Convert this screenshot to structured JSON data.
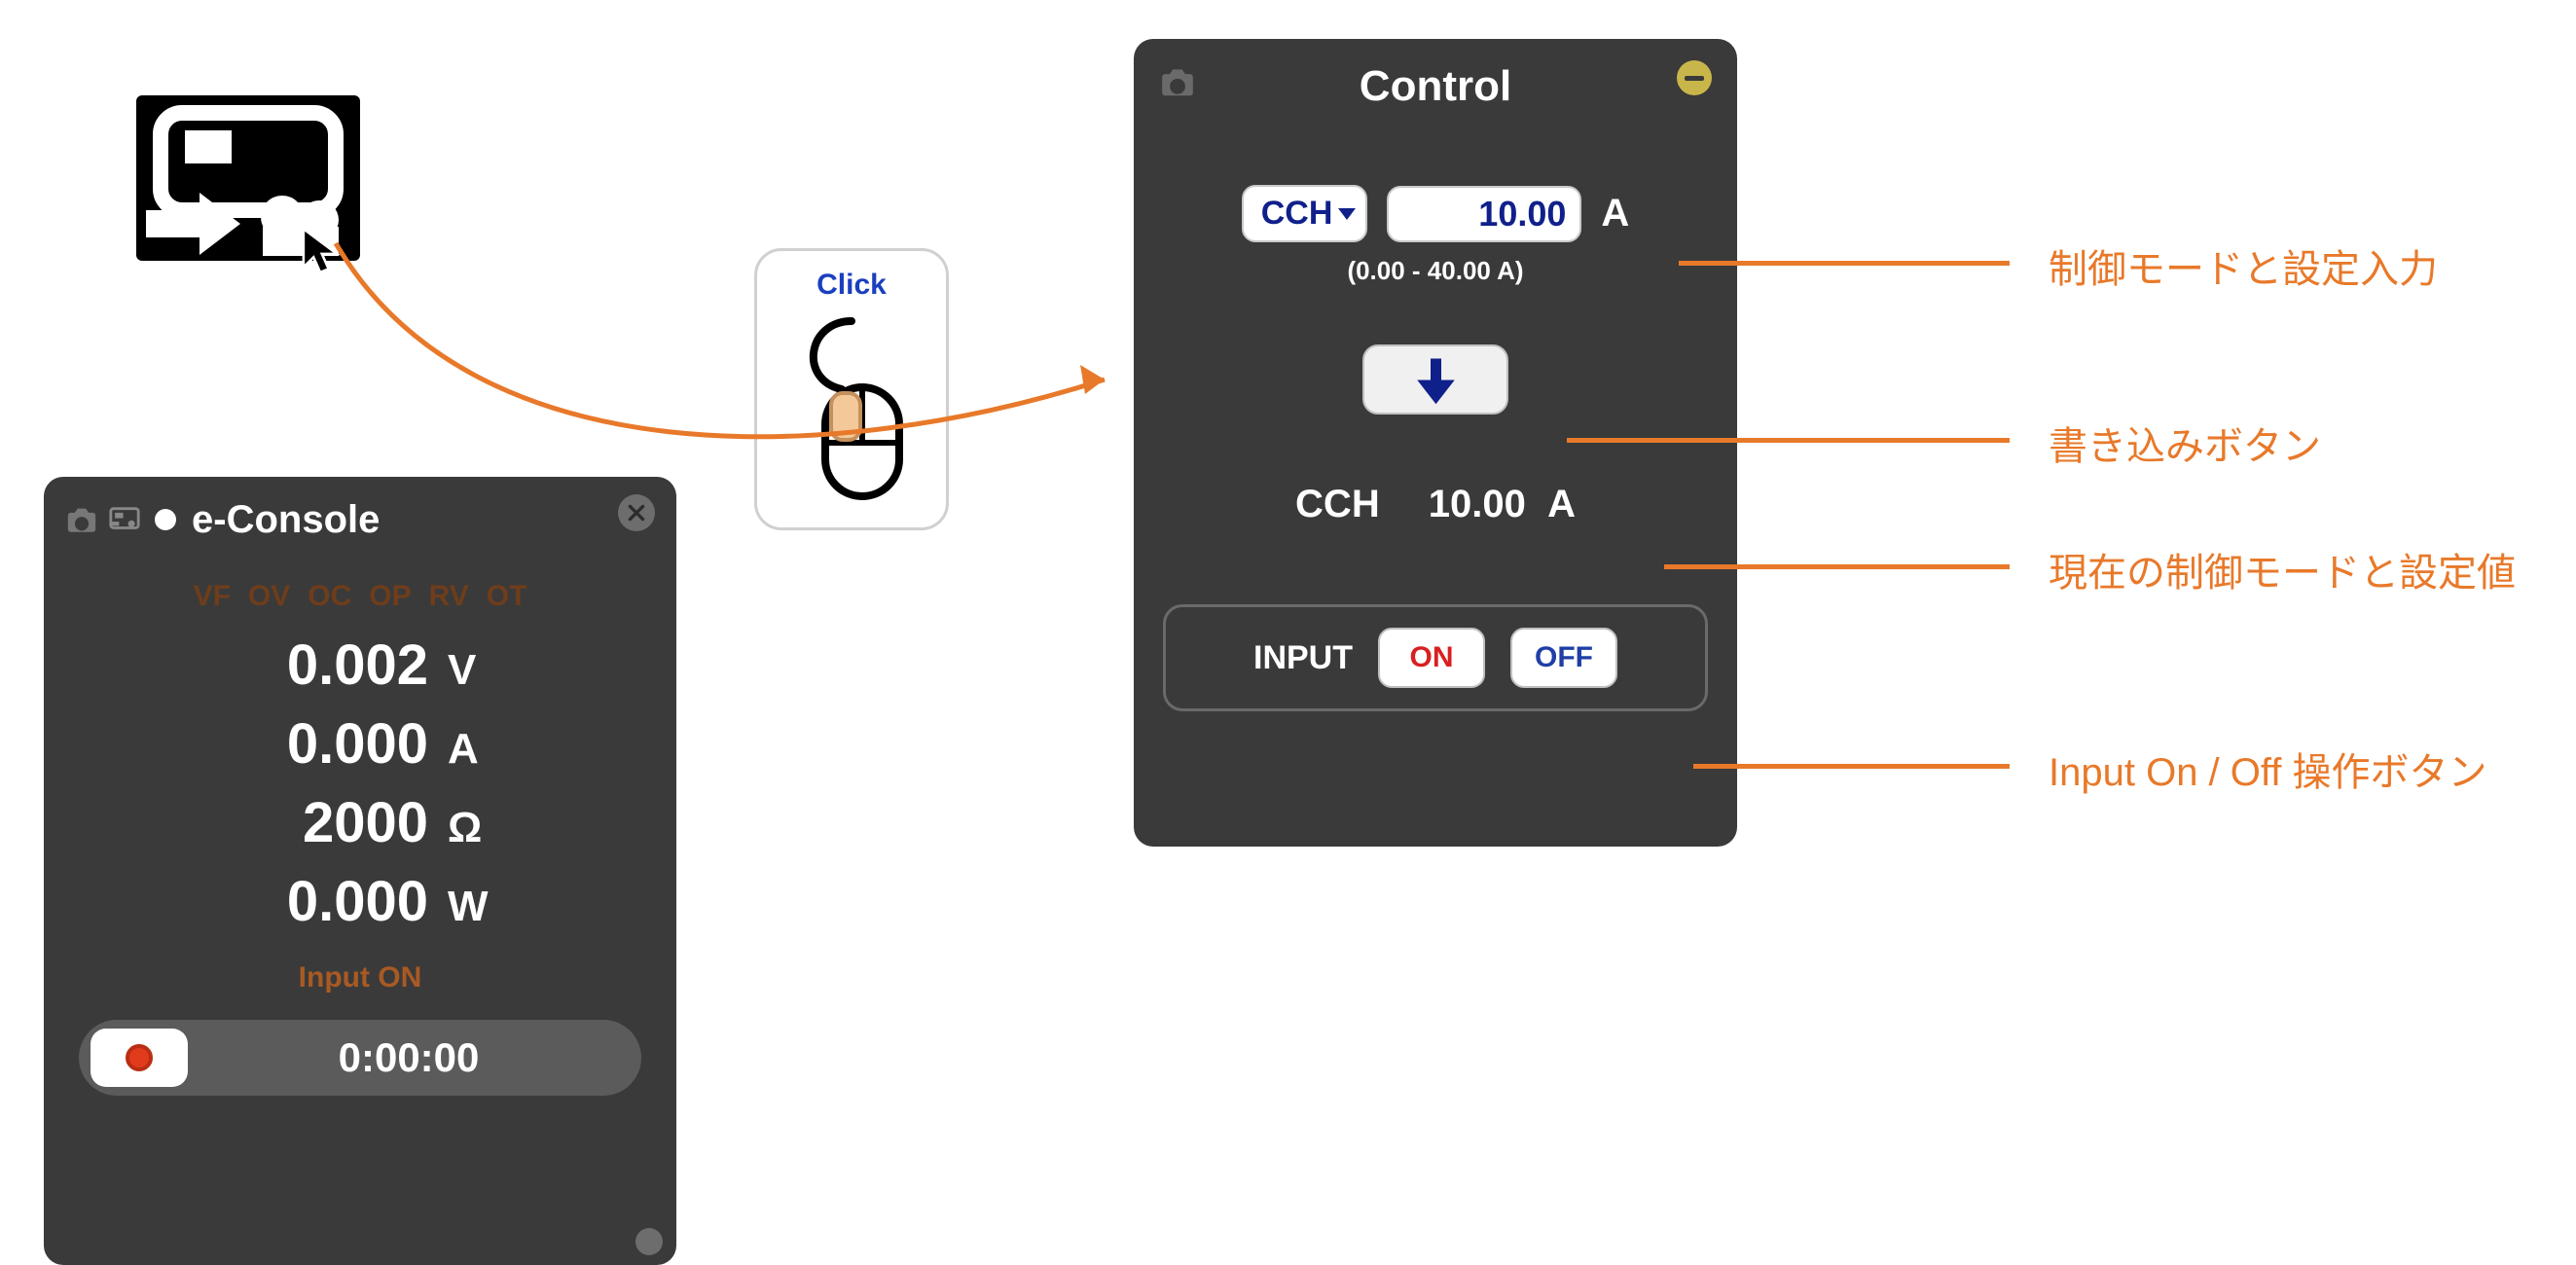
{
  "econsole": {
    "title": "e-Console",
    "alarms": [
      "VF",
      "OV",
      "OC",
      "OP",
      "RV",
      "OT"
    ],
    "measurements": {
      "voltage": {
        "value": "0.002",
        "unit": "V"
      },
      "current": {
        "value": "0.000",
        "unit": "A"
      },
      "resistance": {
        "value": "2000",
        "unit": "Ω"
      },
      "power": {
        "value": "0.000",
        "unit": "W"
      }
    },
    "input_status": "Input ON",
    "rec_time": "0:00:00"
  },
  "click_hint": "Click",
  "control": {
    "title": "Control",
    "mode": "CCH",
    "setpoint": "10.00",
    "setpoint_unit": "A",
    "range_hint": "(0.00 - 40.00 A)",
    "current_mode": "CCH",
    "current_value": "10.00",
    "current_unit": "A",
    "input_label": "INPUT",
    "on_label": "ON",
    "off_label": "OFF"
  },
  "annotations": {
    "mode_input": "制御モードと設定入力",
    "write_button": "書き込みボタン",
    "current_setting": "現在の制御モードと設定値",
    "input_onoff": "Input On / Off  操作ボタン"
  }
}
